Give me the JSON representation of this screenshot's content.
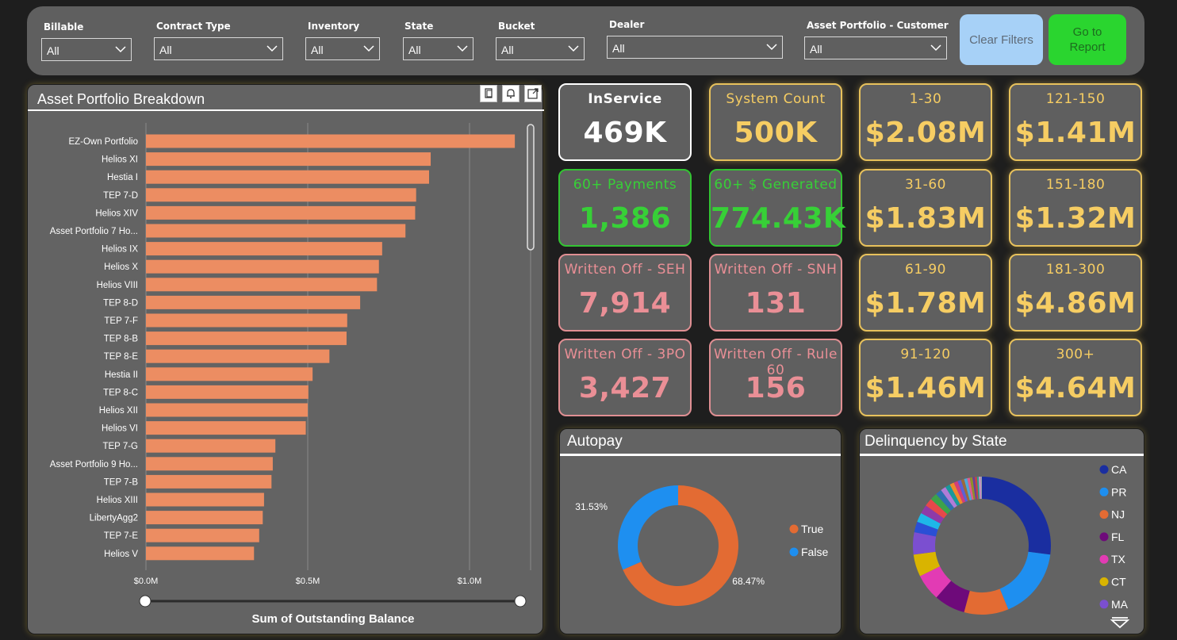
{
  "filters": [
    {
      "label": "Billable",
      "value": "All"
    },
    {
      "label": "Contract Type",
      "value": "All"
    },
    {
      "label": "Inventory",
      "value": "All"
    },
    {
      "label": "State",
      "value": "All"
    },
    {
      "label": "Bucket",
      "value": "All"
    },
    {
      "label": "Dealer",
      "value": "All"
    },
    {
      "label": "Asset Portfolio - Customer",
      "value": "All"
    }
  ],
  "buttons": {
    "clear_filters": "Clear Filters",
    "go_to_report": "Go to Report"
  },
  "bar_panel": {
    "title": "Asset Portfolio Breakdown",
    "icons": [
      "copy-icon",
      "bell-icon",
      "expand-icon"
    ]
  },
  "chart_data": [
    {
      "type": "bar",
      "orientation": "horizontal",
      "title": "Asset Portfolio Breakdown",
      "xlabel": "Sum of Outstanding Balance",
      "ylabel": "",
      "xlim": [
        0,
        1.15
      ],
      "tick_values": [
        0,
        0.5,
        1.0
      ],
      "tick_labels": [
        "$0.0M",
        "$0.5M",
        "$1.0M"
      ],
      "grid": true,
      "color": "#ec8d62",
      "categories": [
        "EZ-Own Portfolio",
        "Helios XI",
        "Hestia I",
        "TEP 7-D",
        "Helios XIV",
        "Asset Portfolio 7 Ho...",
        "Helios IX",
        "Helios X",
        "Helios VIII",
        "TEP 8-D",
        "TEP 7-F",
        "TEP 8-B",
        "TEP 8-E",
        "Hestia II",
        "TEP 8-C",
        "Helios XII",
        "Helios VI",
        "TEP 7-G",
        "Asset Portfolio 9 Ho...",
        "TEP 7-B",
        "Helios XIII",
        "LibertyAgg2",
        "TEP 7-E",
        "Helios V"
      ],
      "values": [
        1.14,
        0.88,
        0.875,
        0.835,
        0.832,
        0.802,
        0.73,
        0.72,
        0.714,
        0.662,
        0.622,
        0.62,
        0.567,
        0.515,
        0.502,
        0.5,
        0.494,
        0.4,
        0.392,
        0.388,
        0.365,
        0.361,
        0.35,
        0.334
      ]
    },
    {
      "type": "pie",
      "donut": true,
      "title": "Autopay",
      "categories": [
        "True",
        "False"
      ],
      "values": [
        68.47,
        31.53
      ],
      "data_labels": [
        "68.47%",
        "31.53%"
      ],
      "colors": [
        "#e36b33",
        "#1e8ff0"
      ],
      "legend": "right"
    },
    {
      "type": "pie",
      "donut": true,
      "title": "Delinquency by State",
      "categories": [
        "CA",
        "PR",
        "NJ",
        "FL",
        "TX",
        "CT",
        "MA"
      ],
      "values": [
        26,
        16,
        10,
        7,
        6,
        5,
        5
      ],
      "colors": [
        "#1a2ea0",
        "#1e8ff0",
        "#e36b33",
        "#6e0a7a",
        "#e23bb4",
        "#d9b400",
        "#7b4fd0"
      ],
      "legend": "right",
      "legend_more": true
    }
  ],
  "cards": [
    {
      "id": "inservice",
      "label": "InService",
      "value": "469K",
      "style": "white"
    },
    {
      "id": "system-count",
      "label": "System Count",
      "value": "500K",
      "style": "gold"
    },
    {
      "id": "bucket-1-30",
      "label": "1-30",
      "value": "$2.08M",
      "style": "gold"
    },
    {
      "id": "bucket-121-150",
      "label": "121-150",
      "value": "$1.41M",
      "style": "gold"
    },
    {
      "id": "60-payments",
      "label": "60+ Payments",
      "value": "1,386",
      "style": "green"
    },
    {
      "id": "60-generated",
      "label": "60+ $ Generated",
      "value": "774.43K",
      "style": "green"
    },
    {
      "id": "bucket-31-60",
      "label": "31-60",
      "value": "$1.83M",
      "style": "gold"
    },
    {
      "id": "bucket-151-180",
      "label": "151-180",
      "value": "$1.32M",
      "style": "gold"
    },
    {
      "id": "written-off-seh",
      "label": "Written Off - SEH",
      "value": "7,914",
      "style": "pink"
    },
    {
      "id": "written-off-snh",
      "label": "Written Off - SNH",
      "value": "131",
      "style": "pink"
    },
    {
      "id": "bucket-61-90",
      "label": "61-90",
      "value": "$1.78M",
      "style": "gold"
    },
    {
      "id": "bucket-181-300",
      "label": "181-300",
      "value": "$4.86M",
      "style": "gold"
    },
    {
      "id": "written-off-3po",
      "label": "Written Off - 3PO",
      "value": "3,427",
      "style": "pink"
    },
    {
      "id": "written-off-rule-60",
      "label": "Written Off - Rule 60",
      "value": "156",
      "style": "pink"
    },
    {
      "id": "bucket-91-120",
      "label": "91-120",
      "value": "$1.46M",
      "style": "gold"
    },
    {
      "id": "bucket-300-plus",
      "label": "300+",
      "value": "$4.64M",
      "style": "gold"
    }
  ]
}
